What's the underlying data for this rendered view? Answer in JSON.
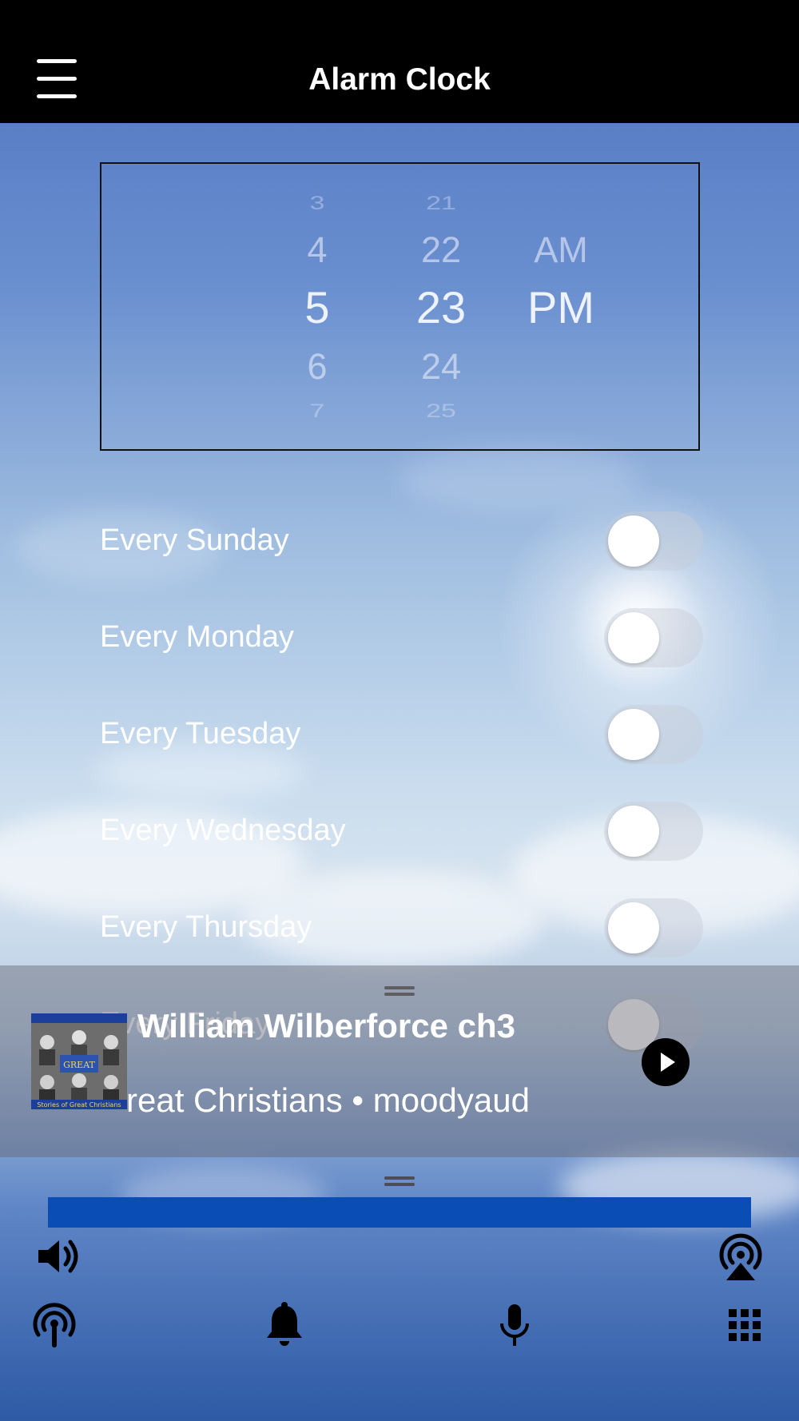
{
  "header": {
    "title": "Alarm Clock"
  },
  "picker": {
    "hours": [
      "3",
      "4",
      "5",
      "6",
      "7"
    ],
    "minutes": [
      "21",
      "22",
      "23",
      "24",
      "25"
    ],
    "periods": [
      "AM",
      "PM"
    ]
  },
  "days": [
    {
      "label": "Every Sunday",
      "enabled": false
    },
    {
      "label": "Every Monday",
      "enabled": false
    },
    {
      "label": "Every Tuesday",
      "enabled": false
    },
    {
      "label": "Every Wednesday",
      "enabled": false
    },
    {
      "label": "Every Thursday",
      "enabled": false
    },
    {
      "label": "Every Friday",
      "enabled": false
    }
  ],
  "player": {
    "title": "William Wilberforce ch3",
    "subtitle": "reat Christians • moodyaud",
    "artwork_text": "GREAT",
    "artwork_caption": "Stories of Great Christians"
  },
  "bottom_bar": {
    "progress": 1.0,
    "icons": [
      "volume-icon",
      "airplay-icon",
      "podcast-icon",
      "bell-icon",
      "microphone-icon",
      "grid-icon"
    ]
  },
  "colors": {
    "accent": "#0a4db5",
    "topbar": "#000000"
  }
}
